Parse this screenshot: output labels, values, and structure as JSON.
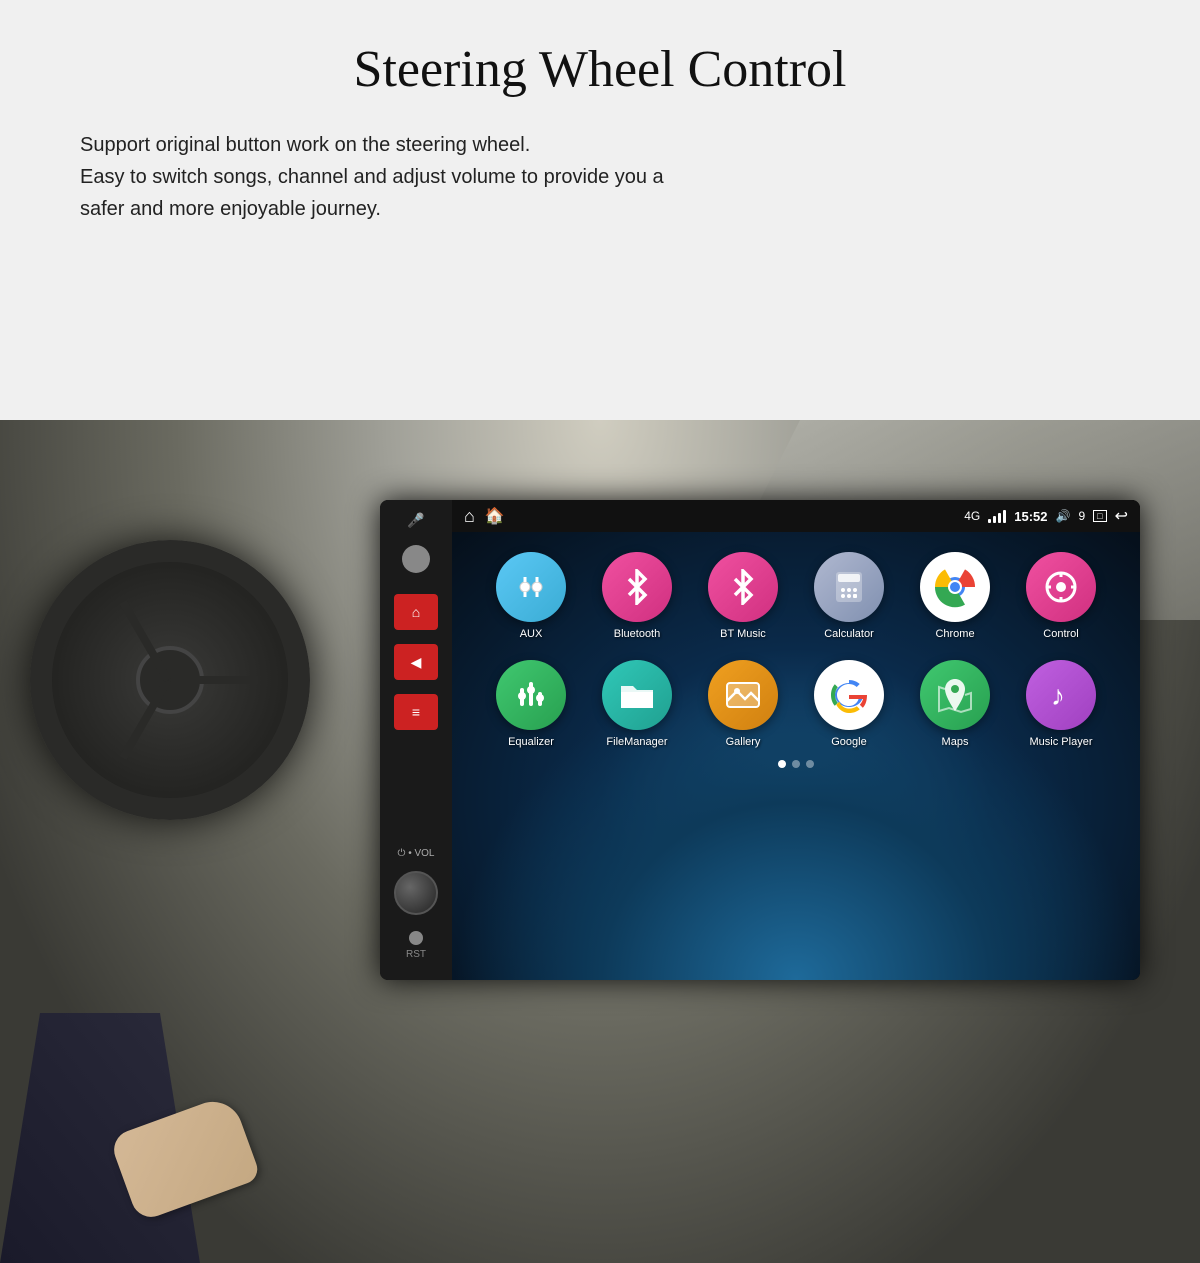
{
  "page": {
    "title": "Steering Wheel Control",
    "description_line1": "Support original button work on the steering wheel.",
    "description_line2": "Easy to switch songs, channel and adjust volume to provide you a",
    "description_line3": "safer and more enjoyable journey."
  },
  "status_bar": {
    "network": "4G",
    "signal": "4",
    "time": "15:52",
    "volume_icon": "🔊",
    "battery_num": "9",
    "home_icon": "⌂",
    "house_icon": "🏠",
    "back_icon": "↩",
    "window_icon": "⬜"
  },
  "control_panel": {
    "mic_label": "🎤",
    "btn1_icon": "⌂",
    "btn2_icon": "◀",
    "btn3_icon": "≡",
    "vol_label": "⏻ • VOL",
    "rst_label": "RST"
  },
  "apps_row1": [
    {
      "id": "aux",
      "label": "AUX",
      "icon": "⚡",
      "color_class": "app-aux"
    },
    {
      "id": "bluetooth",
      "label": "Bluetooth",
      "icon": "🔵",
      "color_class": "app-bluetooth"
    },
    {
      "id": "btmusic",
      "label": "BT Music",
      "icon": "🎵",
      "color_class": "app-btmusic"
    },
    {
      "id": "calculator",
      "label": "Calculator",
      "icon": "🔢",
      "color_class": "app-calculator"
    },
    {
      "id": "chrome",
      "label": "Chrome",
      "icon": "◉",
      "color_class": "app-chrome"
    },
    {
      "id": "control",
      "label": "Control",
      "icon": "🎮",
      "color_class": "app-control"
    }
  ],
  "apps_row2": [
    {
      "id": "equalizer",
      "label": "Equalizer",
      "icon": "🎛",
      "color_class": "app-equalizer"
    },
    {
      "id": "filemanager",
      "label": "FileManager",
      "icon": "📁",
      "color_class": "app-filemanager"
    },
    {
      "id": "gallery",
      "label": "Gallery",
      "icon": "🖼",
      "color_class": "app-gallery"
    },
    {
      "id": "google",
      "label": "Google",
      "icon": "G",
      "color_class": "app-google"
    },
    {
      "id": "maps",
      "label": "Maps",
      "icon": "📍",
      "color_class": "app-maps"
    },
    {
      "id": "musicplayer",
      "label": "Music Player",
      "icon": "♪",
      "color_class": "app-musicplayer"
    }
  ],
  "dots": [
    {
      "active": true
    },
    {
      "active": false
    },
    {
      "active": false
    }
  ]
}
